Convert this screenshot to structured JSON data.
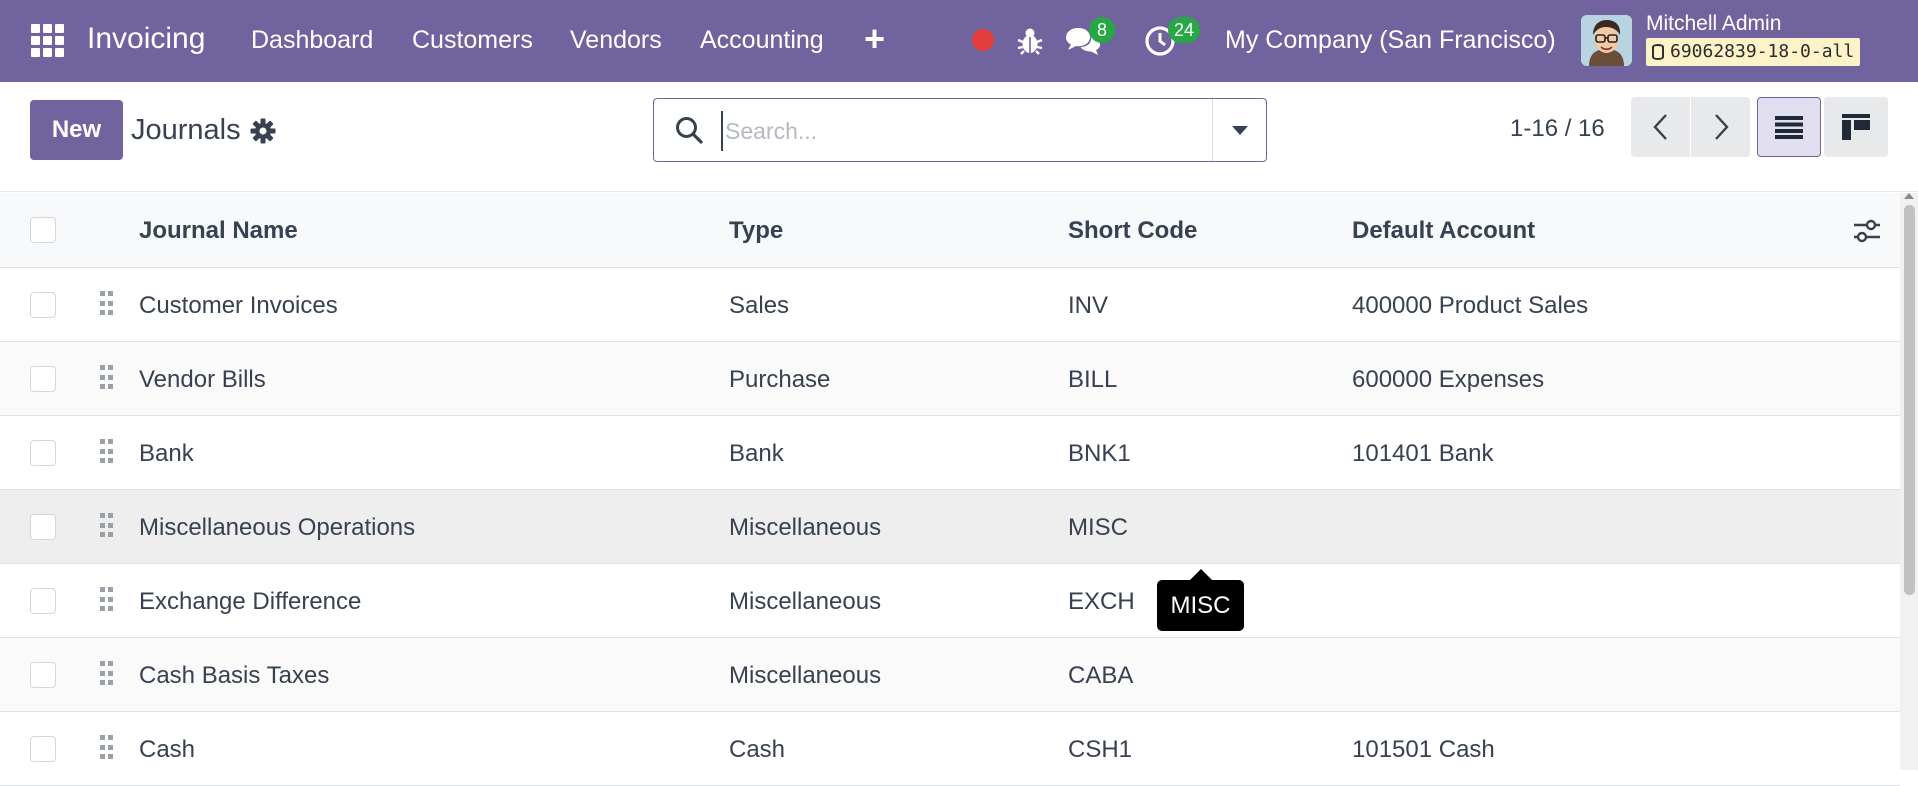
{
  "navbar": {
    "app_name": "Invoicing",
    "menu": [
      "Dashboard",
      "Customers",
      "Vendors",
      "Accounting"
    ],
    "messages_count": "8",
    "activities_count": "24",
    "company": "My Company (San Francisco)",
    "user_name": "Mitchell Admin",
    "database": "69062839-18-0-all",
    "colors": {
      "bar": "#71639e",
      "badge": "#28a745",
      "record": "#e23c3c"
    }
  },
  "control": {
    "new_label": "New",
    "title": "Journals",
    "search_placeholder": "Search...",
    "pager": "1-16 / 16",
    "active_view": "list"
  },
  "list": {
    "columns": [
      "Journal Name",
      "Type",
      "Short Code",
      "Default Account"
    ],
    "rows": [
      {
        "name": "Customer Invoices",
        "type": "Sales",
        "code": "INV",
        "account": "400000 Product Sales"
      },
      {
        "name": "Vendor Bills",
        "type": "Purchase",
        "code": "BILL",
        "account": "600000 Expenses"
      },
      {
        "name": "Bank",
        "type": "Bank",
        "code": "BNK1",
        "account": "101401 Bank"
      },
      {
        "name": "Miscellaneous Operations",
        "type": "Miscellaneous",
        "code": "MISC",
        "account": ""
      },
      {
        "name": "Exchange Difference",
        "type": "Miscellaneous",
        "code": "EXCH",
        "account": ""
      },
      {
        "name": "Cash Basis Taxes",
        "type": "Miscellaneous",
        "code": "CABA",
        "account": ""
      },
      {
        "name": "Cash",
        "type": "Cash",
        "code": "CSH1",
        "account": "101501 Cash"
      }
    ]
  },
  "tooltip": {
    "text": "MISC"
  }
}
